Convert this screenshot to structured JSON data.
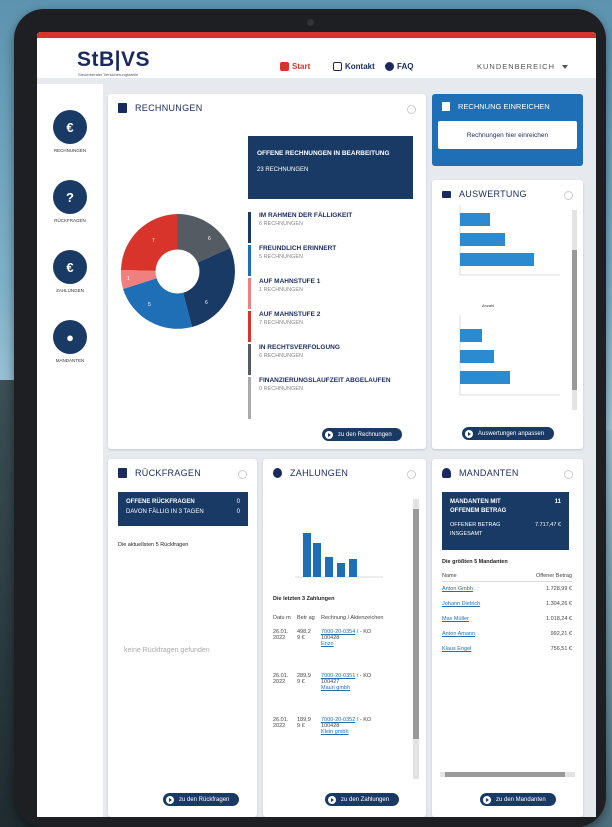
{
  "header": {
    "logo": "StB|VS",
    "logo_sub": "Steuerberater Versicherungsstelle",
    "nav": [
      {
        "label": "Start"
      },
      {
        "label": "Kontakt"
      },
      {
        "label": "FAQ"
      }
    ],
    "kundenbereich": "KUNDENBEREICH"
  },
  "sidebar": {
    "items": [
      {
        "label": "RECHNUNGEN",
        "icon": "invoice-euro-icon",
        "glyph": "€"
      },
      {
        "label": "RÜCKFRAGEN",
        "icon": "question-icon",
        "glyph": "?"
      },
      {
        "label": "ZAHLUNGEN",
        "icon": "payment-icon",
        "glyph": "€"
      },
      {
        "label": "MANDANTEN",
        "icon": "person-icon",
        "glyph": "●"
      }
    ]
  },
  "rechnungen": {
    "title": "RECHNUNGEN",
    "open_title": "OFFENE RECHNUNGEN IN BEARBEITUNG",
    "open_count": "23 RECHNUNGEN",
    "legend": [
      {
        "title": "IM RAHMEN DER FÄLLIGKEIT",
        "count": "6 RECHNUNGEN",
        "color": "#1a3a66"
      },
      {
        "title": "FREUNDLICH ERINNERT",
        "count": "5 RECHNUNGEN",
        "color": "#1e6fb6"
      },
      {
        "title": "AUF MAHNSTUFE 1",
        "count": "1 RECHNUNGEN",
        "color": "#f08080"
      },
      {
        "title": "AUF MAHNSTUFE 2",
        "count": "7 RECHNUNGEN",
        "color": "#d9342b"
      },
      {
        "title": "IN RECHTSVERFOLGUNG",
        "count": "6 RECHNUNGEN",
        "color": "#555b63"
      },
      {
        "title": "FINANZIERUNGSLAUFZEIT ABGELAUFEN",
        "count": "0 RECHNUNGEN",
        "color": "#aaaaaa"
      }
    ],
    "pie_labels": [
      "7",
      "6",
      "6",
      "5",
      "1"
    ],
    "button": "zu den Rechnungen"
  },
  "einreichen": {
    "title": "RECHNUNG EINREICHEN",
    "button": "Rechnungen hier einreichen"
  },
  "auswertung": {
    "title": "AUSWERTUNG",
    "button": "Auswertungen anpassen",
    "sub_title": "Anzahl"
  },
  "rueckfragen": {
    "title": "RÜCKFRAGEN",
    "box_title": "OFFENE RÜCKFRAGEN",
    "box_value": "0",
    "box_sub": "DAVON FÄLLIG IN 3 TAGEN",
    "box_sub_value": "0",
    "latest": "Die aktuellsten 5 Rückfragen",
    "empty": "keine Rückfragen gefunden",
    "button": "zu den Rückfragen"
  },
  "zahlungen": {
    "title": "ZAHLUNGEN",
    "latest": "Die letzten 3 Zahlungen",
    "headers": [
      "Datu m",
      "Betr ag",
      "Rechnung / Aktenzeichen"
    ],
    "rows": [
      {
        "date": "26.01. 2022",
        "amount": "498,2 9 €",
        "invoice": "7000-20-0354",
        "akt": "KO 100428",
        "name": "Enzo"
      },
      {
        "date": "26.01. 2022",
        "amount": "289,9 9 €",
        "invoice": "7000-20-0351",
        "akt": "KO 100427",
        "name": "Mauri gmbh"
      },
      {
        "date": "26.01. 2022",
        "amount": "189,9 9 €",
        "invoice": "7000-20-0352",
        "akt": "KO 100428",
        "name": "Klein gmbh"
      }
    ],
    "button": "zu den Zahlungen"
  },
  "mandanten": {
    "title": "MANDANTEN",
    "box_title": "MANDANTEN MIT OFFENEM BETRAG",
    "box_value": "11",
    "box_sub": "OFFENER BETRAG INSGESAMT",
    "box_sub_value": "7.717,47 €",
    "top": "Die größten 5 Mandanten",
    "headers": [
      "Name",
      "Offener Betrag"
    ],
    "rows": [
      {
        "name": "Anton Gmbh",
        "amount": "1.728,99 €"
      },
      {
        "name": "Johann Dietrich",
        "amount": "1.304,26 €"
      },
      {
        "name": "Max Müller",
        "amount": "1.018,24 €"
      },
      {
        "name": "Anton Amann",
        "amount": "992,21 €"
      },
      {
        "name": "Klaus Engel",
        "amount": "756,51 €"
      }
    ],
    "button": "zu den Mandanten"
  }
}
